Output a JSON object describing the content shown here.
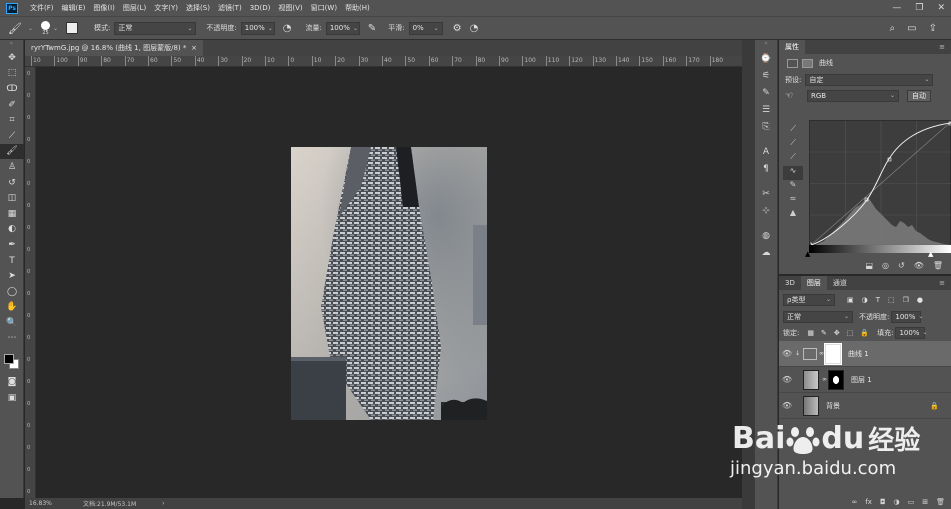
{
  "menu": {
    "logo": "Ps",
    "items": [
      "文件(F)",
      "编辑(E)",
      "图像(I)",
      "图层(L)",
      "文字(Y)",
      "选择(S)",
      "滤镜(T)",
      "3D(D)",
      "视图(V)",
      "窗口(W)",
      "帮助(H)"
    ]
  },
  "options": {
    "brush_size": "25",
    "mode_label": "模式:",
    "mode_value": "正常",
    "opacity_label": "不透明度:",
    "opacity_value": "100%",
    "flow_label": "流量:",
    "flow_value": "100%",
    "smooth_label": "平滑:",
    "smooth_value": "0%"
  },
  "document": {
    "tab_title": "ryrYTwmG.jpg @ 16.8% (曲线 1, 图层蒙版/8) *",
    "close": "×",
    "zoom": "16.83%",
    "doc_info": "文档:21.9M/53.1M",
    "status_arrow": "›"
  },
  "ruler": {
    "labels": [
      "10",
      "100",
      "90",
      "80",
      "70",
      "60",
      "50",
      "40",
      "30",
      "20",
      "10",
      "0",
      "10",
      "20",
      "30",
      "40",
      "50",
      "60",
      "70",
      "80",
      "90",
      "100",
      "110",
      "120",
      "130",
      "140",
      "150",
      "160",
      "170",
      "180"
    ],
    "v_labels": [
      "0",
      "0",
      "0",
      "0",
      "0",
      "0",
      "0",
      "0",
      "0",
      "0",
      "0",
      "0",
      "0",
      "0",
      "0",
      "0",
      "0",
      "0",
      "0",
      "0"
    ]
  },
  "properties": {
    "tab": "属性",
    "adj_title": "曲线",
    "preset_label": "预设:",
    "preset_value": "自定",
    "channel": "RGB",
    "auto_button": "自动"
  },
  "layers_panel": {
    "tabs": [
      "3D",
      "图层",
      "通道"
    ],
    "kind": "ρ类型",
    "blend": "正常",
    "opacity_label": "不透明度:",
    "opacity_value": "100%",
    "lock_label": "锁定:",
    "fill_label": "填充:",
    "fill_value": "100%",
    "layers": [
      {
        "name": "曲线 1",
        "selected": true
      },
      {
        "name": "图层 1",
        "selected": false
      },
      {
        "name": "背景",
        "selected": false
      }
    ]
  },
  "watermark": {
    "brand": "Bai",
    "brand2": "du",
    "suffix": "经验",
    "url": "jingyan.baidu.com"
  },
  "colors": {
    "ui_panel": "#535353",
    "canvas_bg": "#282828",
    "ps_blue": "#31a8ff",
    "baidu_blue": "#2932e1"
  }
}
